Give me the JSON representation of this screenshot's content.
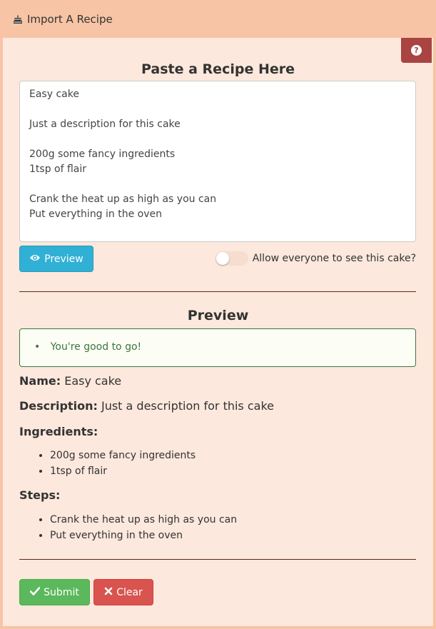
{
  "header": {
    "title": "Import A Recipe",
    "icon": "cake-icon"
  },
  "help": {
    "icon": "question-icon",
    "glyph": "?"
  },
  "paste": {
    "title": "Paste a Recipe Here",
    "text": "Easy cake\n\nJust a description for this cake\n\n200g some fancy ingredients\n1tsp of flair\n\nCrank the heat up as high as you can\nPut everything in the oven"
  },
  "actions": {
    "preview_label": "Preview",
    "public_label": "Allow everyone to see this cake?",
    "public_enabled": false
  },
  "preview": {
    "title": "Preview",
    "alert": "You're good to go!",
    "name_label": "Name:",
    "name": "Easy cake",
    "description_label": "Description:",
    "description": "Just a description for this cake",
    "ingredients_label": "Ingredients:",
    "ingredients": [
      "200g some fancy ingredients",
      "1tsp of flair"
    ],
    "steps_label": "Steps:",
    "steps": [
      "Crank the heat up as high as you can",
      "Put everything in the oven"
    ]
  },
  "footer": {
    "submit_label": "Submit",
    "clear_label": "Clear"
  },
  "colors": {
    "header": "#f7c4a5",
    "background": "#fce8dc",
    "help": "#a94442",
    "preview_button": "#31b0d5",
    "submit": "#5cb85c",
    "clear": "#d9534f",
    "success": "#3c763d"
  }
}
